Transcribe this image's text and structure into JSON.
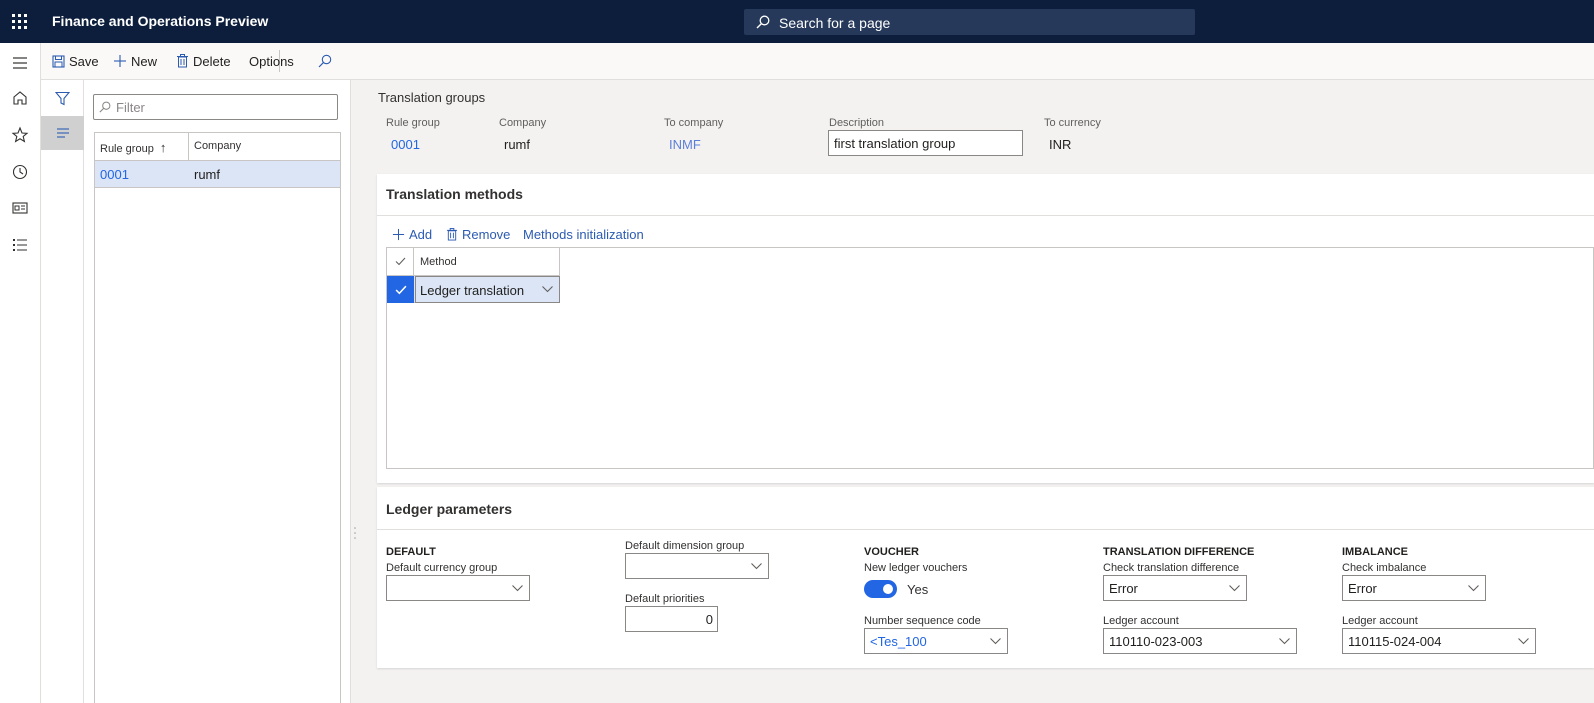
{
  "app": {
    "title": "Finance and Operations Preview",
    "search_placeholder": "Search for a page"
  },
  "nav_icons": [
    "menu-icon",
    "home-icon",
    "star-icon",
    "clock-icon",
    "workspace-icon",
    "list-icon"
  ],
  "toolbar": {
    "save": "Save",
    "new": "New",
    "delete": "Delete",
    "options": "Options"
  },
  "list": {
    "filter_placeholder": "Filter",
    "columns": [
      "Rule group",
      "Company"
    ],
    "sort_indicator": "↑",
    "rows": [
      {
        "rule_group": "0001",
        "company": "rumf"
      }
    ]
  },
  "header": {
    "title": "Translation groups",
    "rule_group_label": "Rule group",
    "rule_group_value": "0001",
    "company_label": "Company",
    "company_value": "rumf",
    "to_company_label": "To company",
    "to_company_value": "INMF",
    "description_label": "Description",
    "description_value": "first translation group",
    "to_currency_label": "To currency",
    "to_currency_value": "INR"
  },
  "methods": {
    "title": "Translation methods",
    "add": "Add",
    "remove": "Remove",
    "init": "Methods initialization",
    "column": "Method",
    "rows": [
      {
        "method": "Ledger translation"
      }
    ]
  },
  "ledger": {
    "title": "Ledger parameters",
    "default": {
      "header": "DEFAULT",
      "currency_group_label": "Default currency group",
      "currency_group_value": ""
    },
    "dimension": {
      "label": "Default dimension group",
      "value": "",
      "priorities_label": "Default priorities",
      "priorities_value": "0"
    },
    "voucher": {
      "header": "VOUCHER",
      "new_vouchers_label": "New ledger vouchers",
      "new_vouchers_value": "Yes",
      "number_seq_label": "Number sequence code",
      "number_seq_value": "<Tes_100"
    },
    "translation_difference": {
      "header": "TRANSLATION DIFFERENCE",
      "check_label": "Check translation difference",
      "check_value": "Error",
      "account_label": "Ledger account",
      "account_value": "110110-023-003"
    },
    "imbalance": {
      "header": "IMBALANCE",
      "check_label": "Check imbalance",
      "check_value": "Error",
      "account_label": "Ledger account",
      "account_value": "110115-024-004"
    }
  }
}
